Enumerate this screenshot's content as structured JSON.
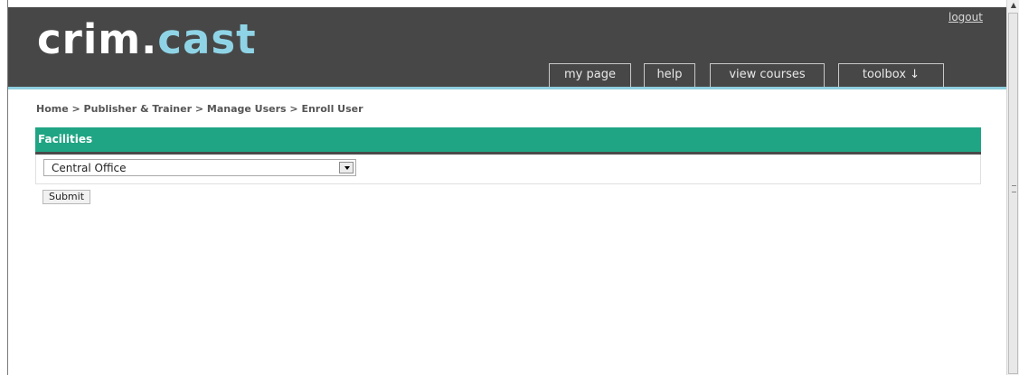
{
  "header": {
    "logo_part1": "crim.",
    "logo_part2": "cast",
    "logout_label": "logout",
    "nav_tabs": [
      "my page",
      "help",
      "view courses",
      "toolbox ↓"
    ]
  },
  "breadcrumb": "Home > Publisher & Trainer > Manage Users > Enroll User",
  "facilities_panel": {
    "title": "Facilities",
    "selected_facility": "Central Office"
  },
  "submit_label": "Submit",
  "colors": {
    "header_bg": "#474747",
    "accent_line": "#8fcfe0",
    "panel_header": "#1fa583",
    "logo_cast": "#8fd4e6"
  }
}
